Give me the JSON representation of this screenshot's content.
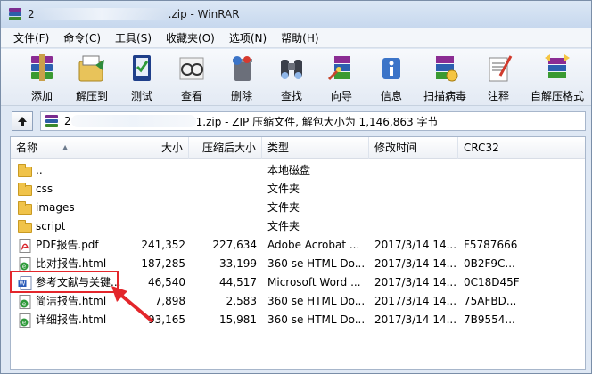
{
  "window": {
    "title_prefix": "2",
    "title_suffix": ".zip - WinRAR"
  },
  "menu": [
    "文件(F)",
    "命令(C)",
    "工具(S)",
    "收藏夹(O)",
    "选项(N)",
    "帮助(H)"
  ],
  "toolbar": [
    {
      "label": "添加",
      "icon": "add-archive-icon"
    },
    {
      "label": "解压到",
      "icon": "extract-to-icon"
    },
    {
      "label": "测试",
      "icon": "test-icon"
    },
    {
      "label": "查看",
      "icon": "view-icon"
    },
    {
      "label": "删除",
      "icon": "delete-icon"
    },
    {
      "label": "查找",
      "icon": "find-binoculars-icon"
    },
    {
      "label": "向导",
      "icon": "wizard-icon"
    },
    {
      "label": "信息",
      "icon": "info-icon"
    },
    {
      "label": "扫描病毒",
      "icon": "scan-virus-icon"
    },
    {
      "label": "注释",
      "icon": "comment-icon"
    },
    {
      "label": "自解压格式",
      "icon": "sfx-icon"
    }
  ],
  "address": {
    "path_prefix": "2",
    "path_suffix": "1.zip - ZIP 压缩文件, 解包大小为 1,146,863 字节"
  },
  "columns": {
    "name": "名称",
    "size": "大小",
    "packed": "压缩后大小",
    "type": "类型",
    "modified": "修改时间",
    "crc": "CRC32"
  },
  "files": [
    {
      "name": "..",
      "size": "",
      "packed": "",
      "type": "本地磁盘",
      "modified": "",
      "crc": "",
      "icon": "folder-icon"
    },
    {
      "name": "css",
      "size": "",
      "packed": "",
      "type": "文件夹",
      "modified": "",
      "crc": "",
      "icon": "folder-icon"
    },
    {
      "name": "images",
      "size": "",
      "packed": "",
      "type": "文件夹",
      "modified": "",
      "crc": "",
      "icon": "folder-icon"
    },
    {
      "name": "script",
      "size": "",
      "packed": "",
      "type": "文件夹",
      "modified": "",
      "crc": "",
      "icon": "folder-icon"
    },
    {
      "name": "PDF报告.pdf",
      "size": "241,352",
      "packed": "227,634",
      "type": "Adobe Acrobat ...",
      "modified": "2017/3/14 14...",
      "crc": "F5787666",
      "icon": "pdf-file-icon"
    },
    {
      "name": "比对报告.html",
      "size": "187,285",
      "packed": "33,199",
      "type": "360 se HTML Do...",
      "modified": "2017/3/14 14...",
      "crc": "0B2F9C...",
      "icon": "html-file-icon"
    },
    {
      "name": "参考文献与关键...",
      "size": "46,540",
      "packed": "44,517",
      "type": "Microsoft Word ...",
      "modified": "2017/3/14 14...",
      "crc": "0C18D45F",
      "icon": "word-file-icon"
    },
    {
      "name": "简洁报告.html",
      "size": "7,898",
      "packed": "2,583",
      "type": "360 se HTML Do...",
      "modified": "2017/3/14 14...",
      "crc": "75AFBD...",
      "icon": "html-file-icon"
    },
    {
      "name": "详细报告.html",
      "size": "93,165",
      "packed": "15,981",
      "type": "360 se HTML Do...",
      "modified": "2017/3/14 14...",
      "crc": "7B9554...",
      "icon": "html-file-icon"
    }
  ],
  "colors": {
    "highlight": "#e3262b",
    "window_bg": "#dfe8f4"
  }
}
